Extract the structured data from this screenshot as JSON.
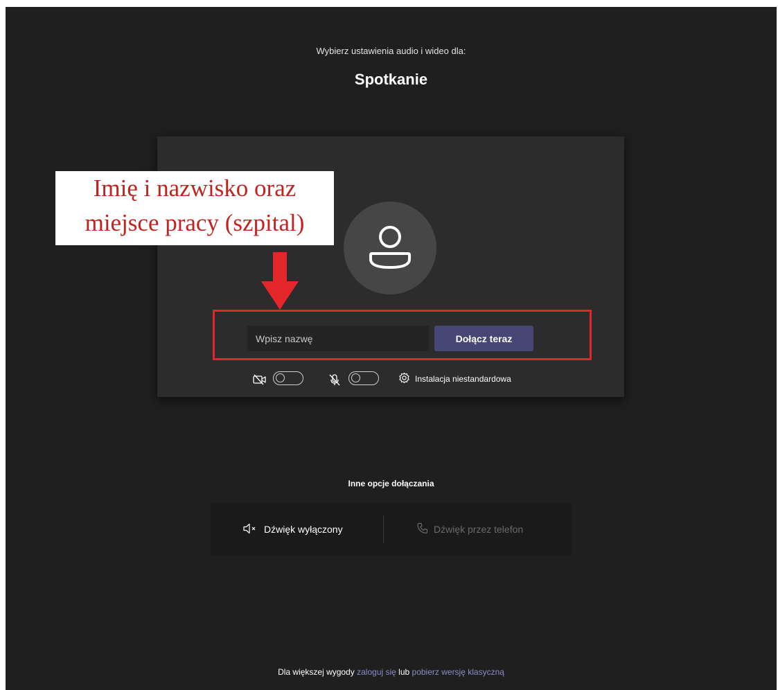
{
  "header": {
    "subtitle": "Wybierz ustawienia audio i wideo dla:",
    "title": "Spotkanie"
  },
  "join_card": {
    "avatar_icon": "person-icon",
    "name_input": {
      "value": "",
      "placeholder": "Wpisz nazwę"
    },
    "join_button_label": "Dołącz teraz",
    "camera": {
      "icon": "camera-off-icon",
      "enabled": false
    },
    "microphone": {
      "icon": "mic-off-icon",
      "enabled": false
    },
    "custom_setup": {
      "icon": "gear-icon",
      "label": "Instalacja niestandardowa"
    }
  },
  "annotation": {
    "line1": "Imię i nazwisko oraz",
    "line2": "miejsce pracy (szpital)",
    "color": "#e3262a",
    "arrow_icon": "arrow-down-icon"
  },
  "other_options": {
    "title": "Inne opcje dołączania",
    "audio_off": {
      "icon": "speaker-muted-icon",
      "label": "Dźwięk wyłączony"
    },
    "phone_audio": {
      "icon": "phone-icon",
      "label": "Dźwięk przez telefon",
      "disabled": true
    }
  },
  "footer": {
    "text_before": "Dla większej wygody",
    "link_signin": "zaloguj się",
    "text_middle": "lub",
    "link_download": "pobierz wersję klasyczną"
  },
  "colors": {
    "background": "#201f1f",
    "card": "#2d2c2c",
    "accent": "#464775",
    "link": "#8b8cc7"
  }
}
